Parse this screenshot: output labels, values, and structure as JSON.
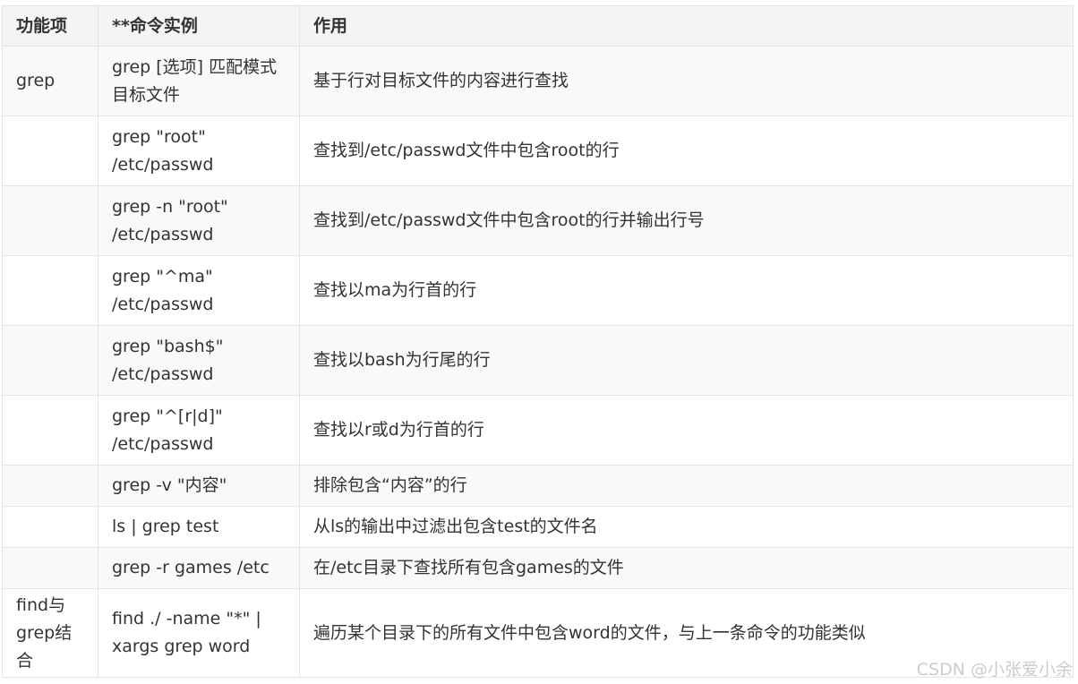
{
  "table": {
    "headers": {
      "feature": "功能项",
      "command": "**命令实例",
      "effect": "作用"
    },
    "rows": [
      {
        "feature": "grep",
        "command": "grep [选项] 匹配模式 目标文件",
        "effect": "基于行对目标文件的内容进行查找"
      },
      {
        "feature": "",
        "command": "grep \"root\" /etc/passwd",
        "effect": "查找到/etc/passwd文件中包含root的行"
      },
      {
        "feature": "",
        "command": "grep -n \"root\" /etc/passwd",
        "effect": "查找到/etc/passwd文件中包含root的行并输出行号"
      },
      {
        "feature": "",
        "command": "grep \"^ma\" /etc/passwd",
        "effect": "查找以ma为行首的行"
      },
      {
        "feature": "",
        "command": "grep \"bash$\" /etc/passwd",
        "effect": "查找以bash为行尾的行"
      },
      {
        "feature": "",
        "command": "grep \"^[r|d]\" /etc/passwd",
        "effect": "查找以r或d为行首的行"
      },
      {
        "feature": "",
        "command": "grep -v \"内容\"",
        "effect": "排除包含“内容”的行"
      },
      {
        "feature": "",
        "command": "ls | grep test",
        "effect": "从ls的输出中过滤出包含test的文件名"
      },
      {
        "feature": "",
        "command": "grep -r games /etc",
        "effect": "在/etc目录下查找所有包含games的文件"
      },
      {
        "feature": "find与grep结合",
        "command": "find ./ -name \"*\" | xargs grep word",
        "effect": "遍历某个目录下的所有文件中包含word的文件，与上一条命令的功能类似"
      }
    ]
  },
  "watermark": "CSDN @小张爱小余"
}
